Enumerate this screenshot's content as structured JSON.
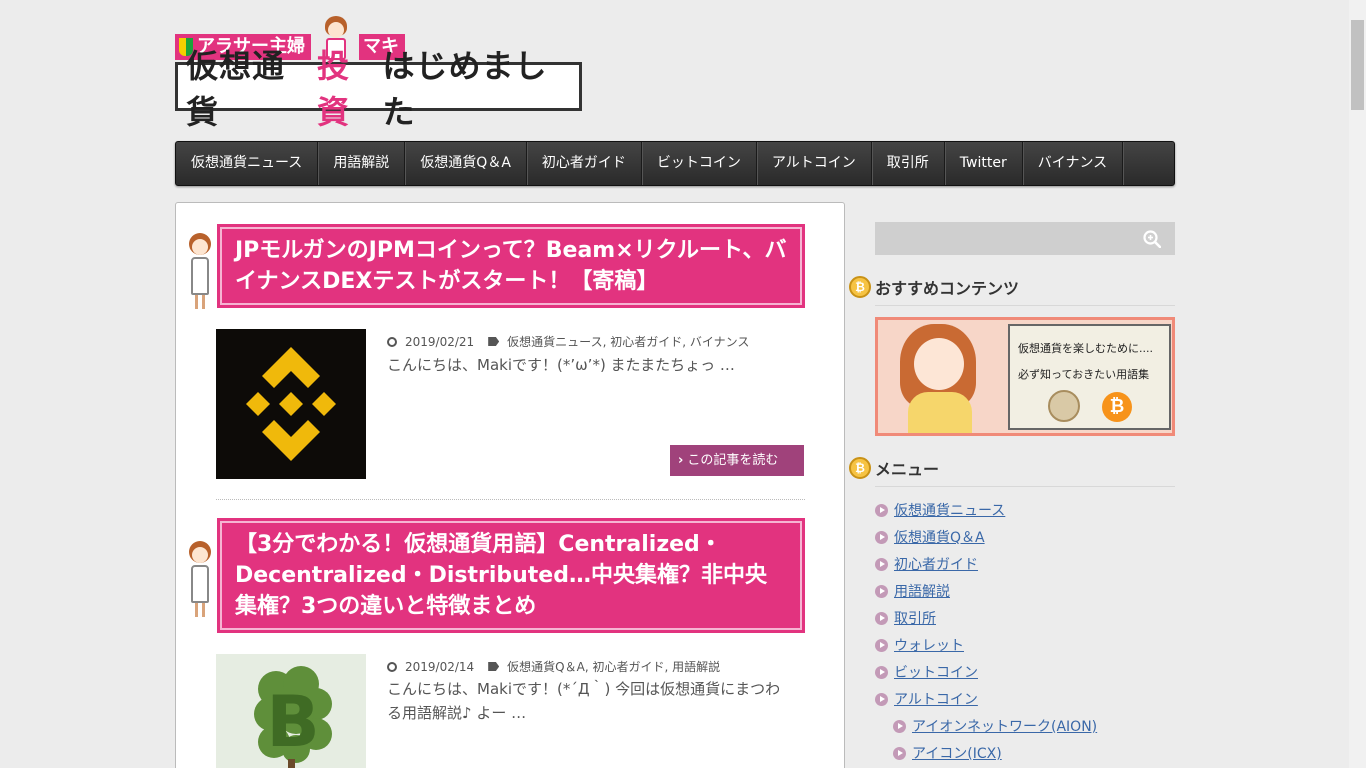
{
  "header": {
    "badge_text": "アラサー主婦",
    "badge_name": "マキ",
    "title_part1": "仮想通貨",
    "title_accent": "投資",
    "title_part2": "はじめました"
  },
  "nav": {
    "items": [
      {
        "label": "仮想通貨ニュース"
      },
      {
        "label": "用語解説"
      },
      {
        "label": "仮想通貨Q＆A"
      },
      {
        "label": "初心者ガイド"
      },
      {
        "label": "ビットコイン"
      },
      {
        "label": "アルトコイン"
      },
      {
        "label": "取引所"
      },
      {
        "label": "Twitter"
      },
      {
        "label": "バイナンス"
      }
    ]
  },
  "articles": [
    {
      "title": "JPモルガンのJPMコインって？Beam×リクルート、バイナンスDEXテストがスタート！【寄稿】",
      "date": "2019/02/21",
      "categories": "仮想通貨ニュース, 初心者ガイド, バイナンス",
      "excerpt": "こんにちは、Makiです！(*’ω’*) またまたちょっ …",
      "read_more": "この記事を読む"
    },
    {
      "title": "【3分でわかる！仮想通貨用語】Centralized・Decentralized・Distributed…中央集権？非中央集権？3つの違いと特徴まとめ",
      "date": "2019/02/14",
      "categories": "仮想通貨Q＆A, 初心者ガイド, 用語解説",
      "excerpt": "こんにちは、Makiです！(*´Д｀) 今回は仮想通貨にまつわる用語解説♪ よー …"
    }
  ],
  "sidebar": {
    "search_placeholder": "",
    "recommend_heading": "おすすめコンテンツ",
    "banner_line1": "仮想通貨を楽しむために....",
    "banner_line2": "必ず知っておきたい用語集",
    "menu_heading": "メニュー",
    "menu_items": [
      {
        "label": "仮想通貨ニュース"
      },
      {
        "label": "仮想通貨Q＆A"
      },
      {
        "label": "初心者ガイド"
      },
      {
        "label": "用語解説"
      },
      {
        "label": "取引所"
      },
      {
        "label": "ウォレット"
      },
      {
        "label": "ビットコイン"
      },
      {
        "label": "アルトコイン"
      },
      {
        "label": "アイオンネットワーク(AION)"
      },
      {
        "label": "アイコン(ICX)"
      }
    ]
  },
  "colors": {
    "accent": "#e2337f",
    "read_more": "#a0427b",
    "nav_bg": "#333333",
    "link": "#3a68a8"
  }
}
